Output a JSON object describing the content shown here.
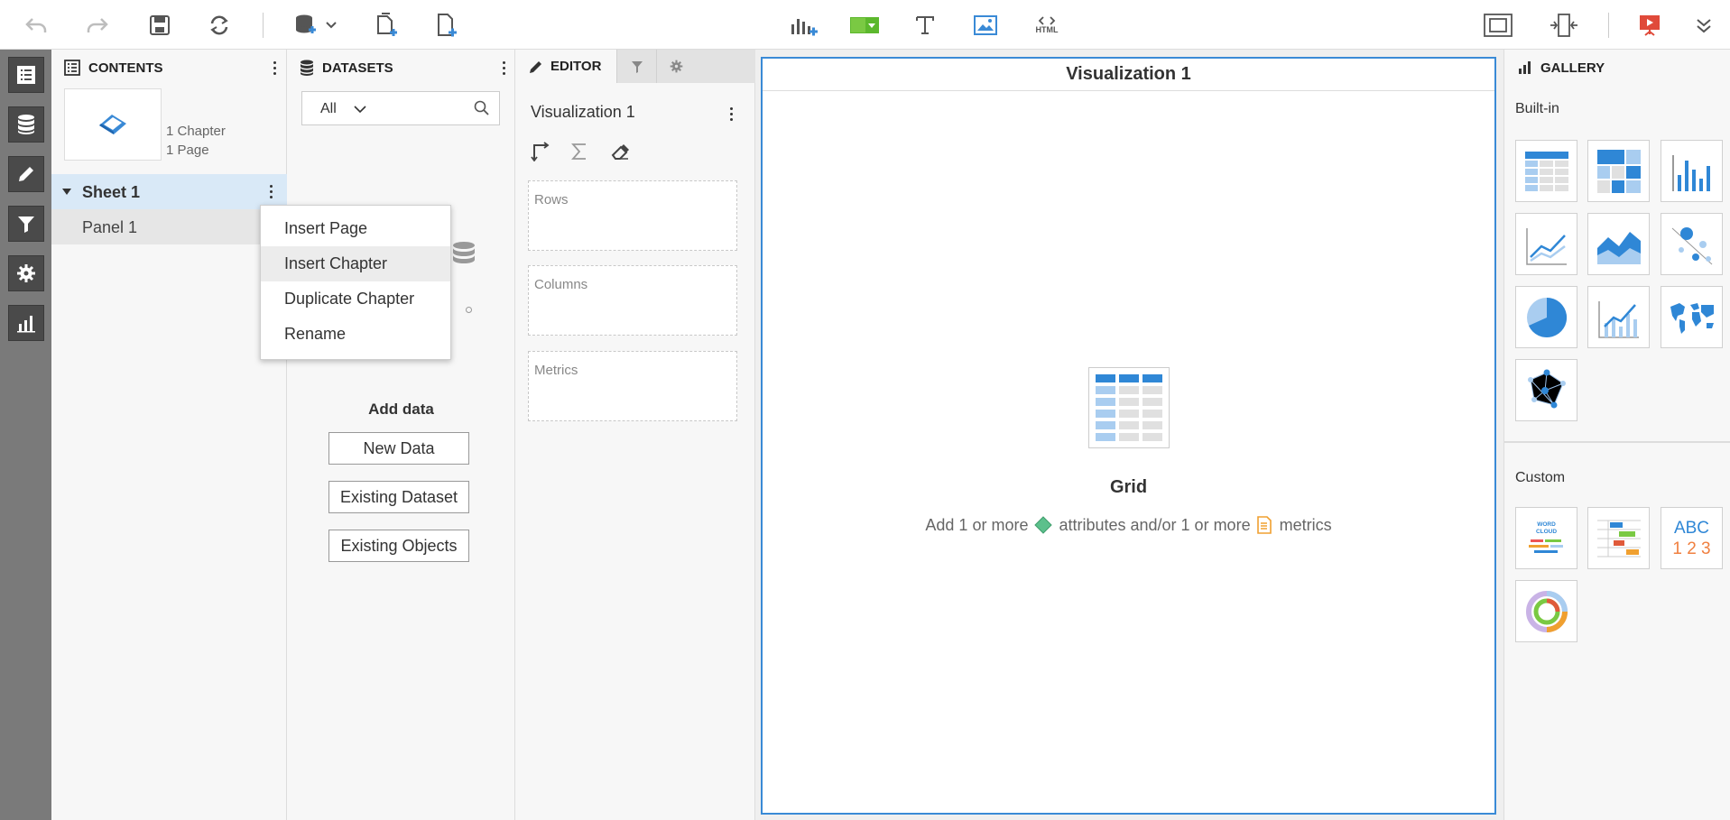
{
  "contents": {
    "title": "CONTENTS",
    "chapter_count": "1 Chapter",
    "page_count": "1 Page",
    "sheet_label": "Sheet 1",
    "panel_label": "Panel 1"
  },
  "context_menu": {
    "items": [
      "Insert Page",
      "Insert Chapter",
      "Duplicate Chapter",
      "Rename"
    ],
    "hover_item": "Insert Chapter"
  },
  "datasets": {
    "title": "DATASETS",
    "filter_value": "All",
    "add_data_title": "Add data",
    "buttons": {
      "new_data": "New Data",
      "existing_dataset": "Existing Dataset",
      "existing_objects": "Existing Objects"
    }
  },
  "editor": {
    "tab_label": "EDITOR",
    "viz_name": "Visualization 1",
    "zones": [
      "Rows",
      "Columns",
      "Metrics"
    ]
  },
  "canvas": {
    "viz_title": "Visualization 1",
    "placeholder_name": "Grid",
    "hint_part1": "Add 1 or more",
    "hint_part2": "attributes and/or 1 or more",
    "hint_part3": "metrics"
  },
  "toolbar": {
    "html_label": "HTML"
  },
  "gallery": {
    "title": "GALLERY",
    "builtin_label": "Built-in",
    "custom_label": "Custom",
    "builtin_icons": [
      "grid-viz-icon",
      "heatmap-viz-icon",
      "bar-chart-viz-icon",
      "line-chart-viz-icon",
      "area-chart-viz-icon",
      "bubble-chart-viz-icon",
      "pie-chart-viz-icon",
      "combo-chart-viz-icon",
      "map-viz-icon",
      "network-viz-icon"
    ],
    "custom_icons": [
      "word-cloud-viz-icon",
      "gantt-viz-icon",
      "kpi-viz-icon",
      "sunburst-viz-icon"
    ],
    "word_cloud_text": "WORD CLOUD",
    "kpi_letters": "ABC",
    "kpi_numbers": "1 2 3"
  },
  "colors": {
    "accent": "#3a8ad6",
    "rail": "#7a7a7a",
    "selected_row": "#d9e9f7",
    "attribute_green": "#5cc08c",
    "metric_orange": "#f0a030"
  }
}
